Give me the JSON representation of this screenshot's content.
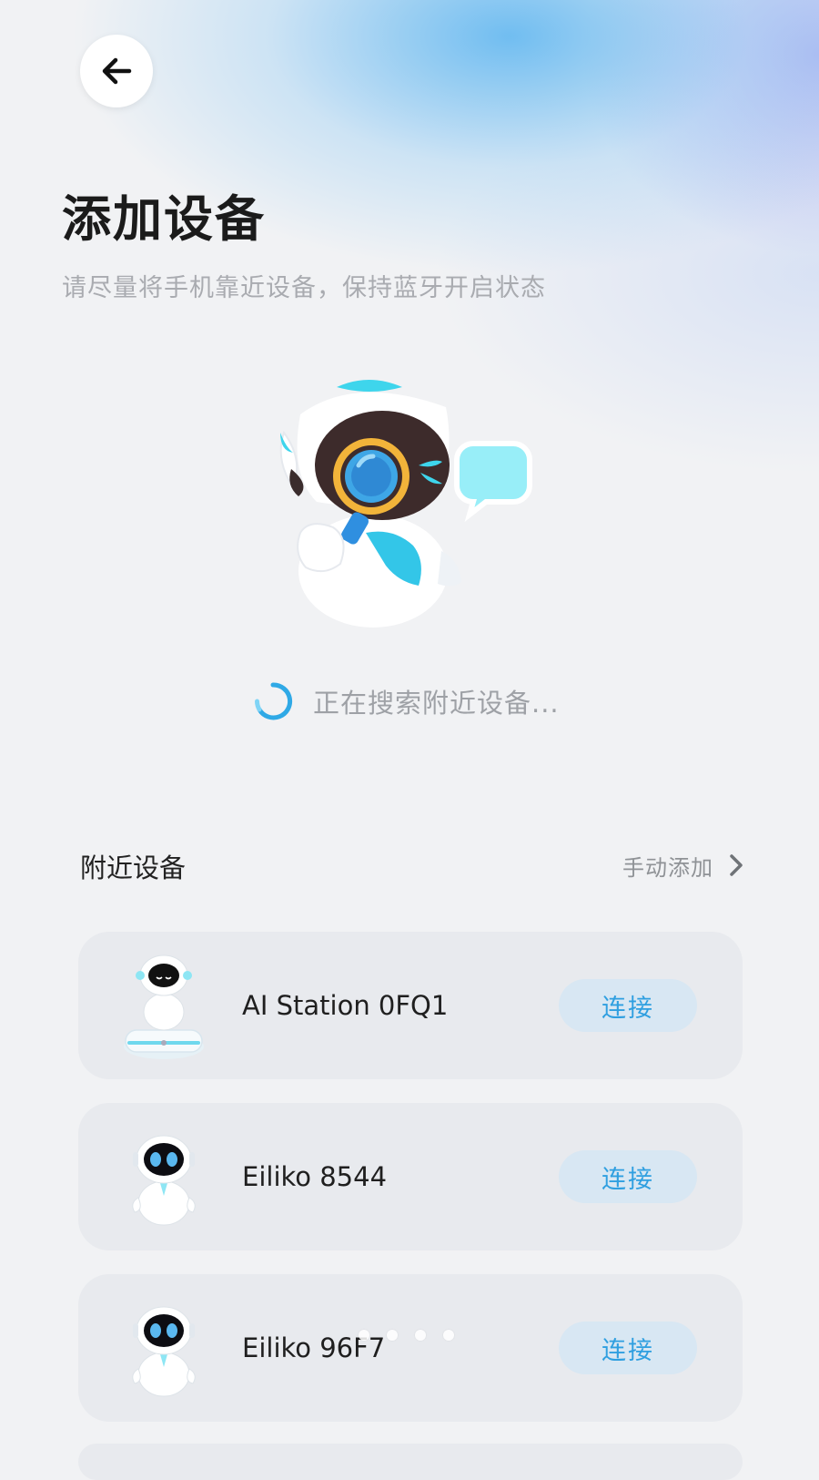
{
  "header": {
    "back_icon": "arrow-left-icon",
    "title": "添加设备",
    "subtitle": "请尽量将手机靠近设备，保持蓝牙开启状态"
  },
  "search": {
    "status_text": "正在搜索附近设备...",
    "spinner_icon": "loading-spinner-icon",
    "illustration": "robot-with-magnifier-illustration"
  },
  "nearby": {
    "section_title": "附近设备",
    "manual_add_label": "手动添加",
    "manual_add_icon": "chevron-right-icon",
    "devices": [
      {
        "name": "AI Station 0FQ1",
        "connect_label": "连接",
        "thumb": "ai-station-robot-icon"
      },
      {
        "name": "Eiliko 8544",
        "connect_label": "连接",
        "thumb": "eiliko-robot-icon"
      },
      {
        "name": "Eiliko 96F7",
        "connect_label": "连接",
        "thumb": "eiliko-robot-icon"
      }
    ]
  },
  "pager": {
    "dots": 4
  },
  "colors": {
    "accent": "#2f9fe0",
    "connect_bg": "#d8e7f3",
    "card_bg": "#e8eaee",
    "page_bg": "#f1f2f4",
    "subtitle_text": "#a9abb0"
  }
}
